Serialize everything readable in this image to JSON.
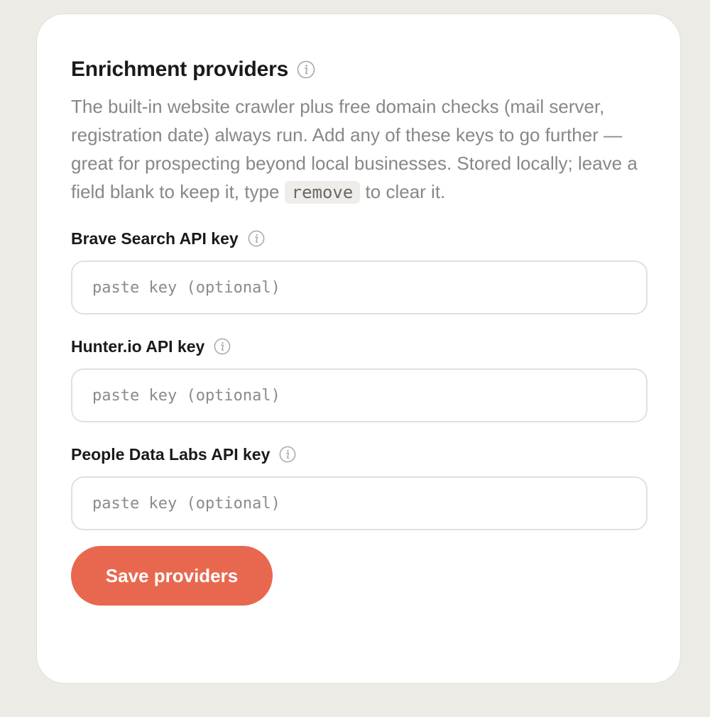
{
  "card": {
    "title": "Enrichment providers",
    "description_before_code": "The built-in website crawler plus free domain checks (mail server, registration date) always run. Add any of these keys to go further — great for prospecting beyond local businesses. Stored locally; leave a field blank to keep it, type ",
    "description_code": "remove",
    "description_after_code": " to clear it."
  },
  "fields": [
    {
      "label": "Brave Search API key",
      "value": "",
      "placeholder": "paste key (optional)",
      "icon": "info-icon"
    },
    {
      "label": "Hunter.io API key",
      "value": "",
      "placeholder": "paste key (optional)",
      "icon": "info-icon"
    },
    {
      "label": "People Data Labs API key",
      "value": "",
      "placeholder": "paste key (optional)",
      "icon": "info-icon"
    }
  ],
  "actions": {
    "save_label": "Save providers"
  },
  "colors": {
    "accent": "#e8684f",
    "background": "#edebe6",
    "card": "#ffffff",
    "muted_text": "#8a8784"
  }
}
